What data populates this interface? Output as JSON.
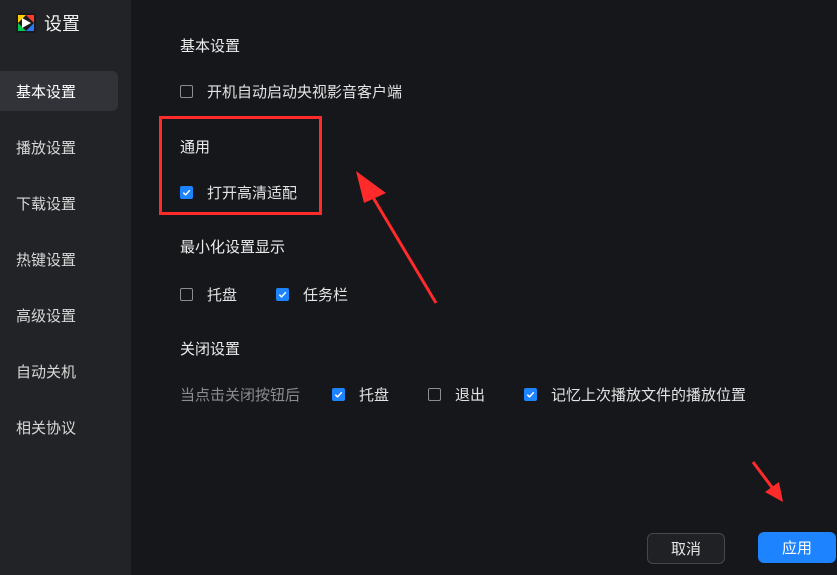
{
  "app": {
    "title": "设置"
  },
  "sidebar": {
    "items": [
      {
        "label": "基本设置",
        "active": true
      },
      {
        "label": "播放设置"
      },
      {
        "label": "下载设置"
      },
      {
        "label": "热键设置"
      },
      {
        "label": "高级设置"
      },
      {
        "label": "自动关机"
      },
      {
        "label": "相关协议"
      }
    ]
  },
  "sections": {
    "basic": {
      "title": "基本设置",
      "autostart": {
        "label": "开机自动启动央视影音客户端",
        "checked": false
      }
    },
    "general": {
      "title": "通用",
      "hd_adapt": {
        "label": "打开高清适配",
        "checked": true
      }
    },
    "minimize": {
      "title": "最小化设置显示",
      "tray": {
        "label": "托盘",
        "checked": false
      },
      "taskbar": {
        "label": "任务栏",
        "checked": true
      }
    },
    "close": {
      "title": "关闭设置",
      "row_label": "当点击关闭按钮后",
      "tray": {
        "label": "托盘",
        "checked": true
      },
      "exit": {
        "label": "退出",
        "checked": false
      },
      "remember": {
        "label": "记忆上次播放文件的播放位置",
        "checked": true
      }
    }
  },
  "footer": {
    "cancel_label": "取消",
    "apply_label": "应用"
  },
  "colors": {
    "accent": "#1e83ff",
    "annotation": "#ff2a2a",
    "background": "#16171b",
    "sidebar": "#222326"
  }
}
